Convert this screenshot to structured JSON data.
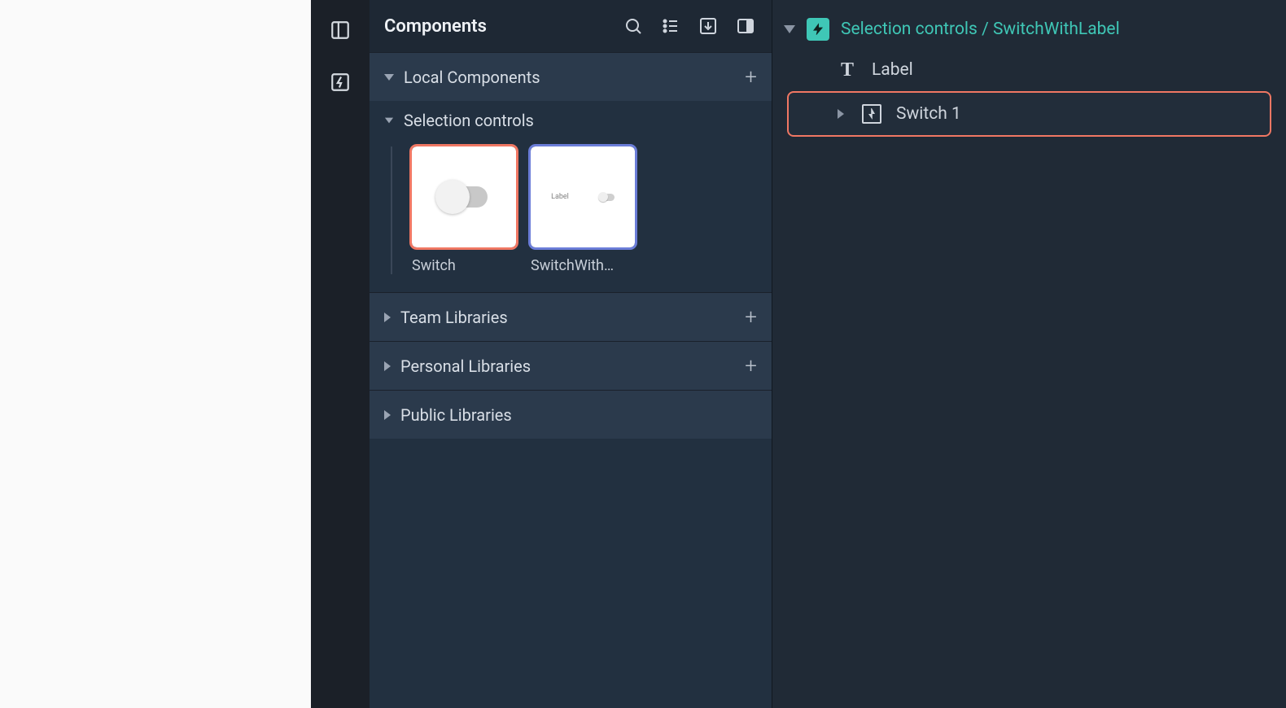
{
  "panel": {
    "title": "Components",
    "sections": {
      "local": "Local Components",
      "group": "Selection controls",
      "team": "Team Libraries",
      "personal": "Personal Libraries",
      "public": "Public Libraries"
    },
    "cards": {
      "switch": "Switch",
      "switchWithLabel": "SwitchWith…",
      "miniLabel": "Label"
    }
  },
  "layers": {
    "root": "Selection controls / SwitchWithLabel",
    "items": [
      {
        "label": "Label"
      },
      {
        "label": "Switch 1"
      }
    ]
  }
}
